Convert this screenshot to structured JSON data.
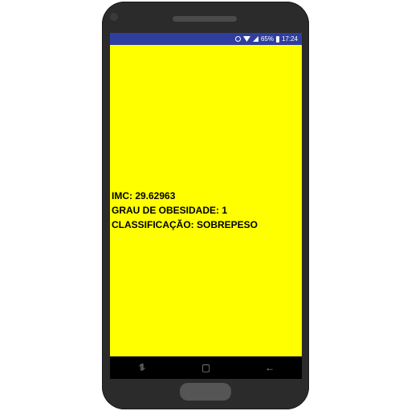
{
  "statusbar": {
    "battery_pct": "65%",
    "time": "17:24",
    "icons": [
      "alarm-icon",
      "wifi-icon",
      "signal-icon",
      "battery-icon"
    ]
  },
  "result": {
    "imc": "IMC: 29.62963",
    "grau": "GRAU DE OBESIDADE: 1",
    "classificacao": "CLASSIFICAÇÃO: SOBREPESO"
  },
  "navbar": {
    "recents_glyph": "⥮",
    "home_glyph": "▢",
    "back_glyph": "←"
  },
  "colors": {
    "background": "#ffff00",
    "statusbar": "#303f9f",
    "navbar": "#000000",
    "phone_frame": "#2b2b2b"
  }
}
